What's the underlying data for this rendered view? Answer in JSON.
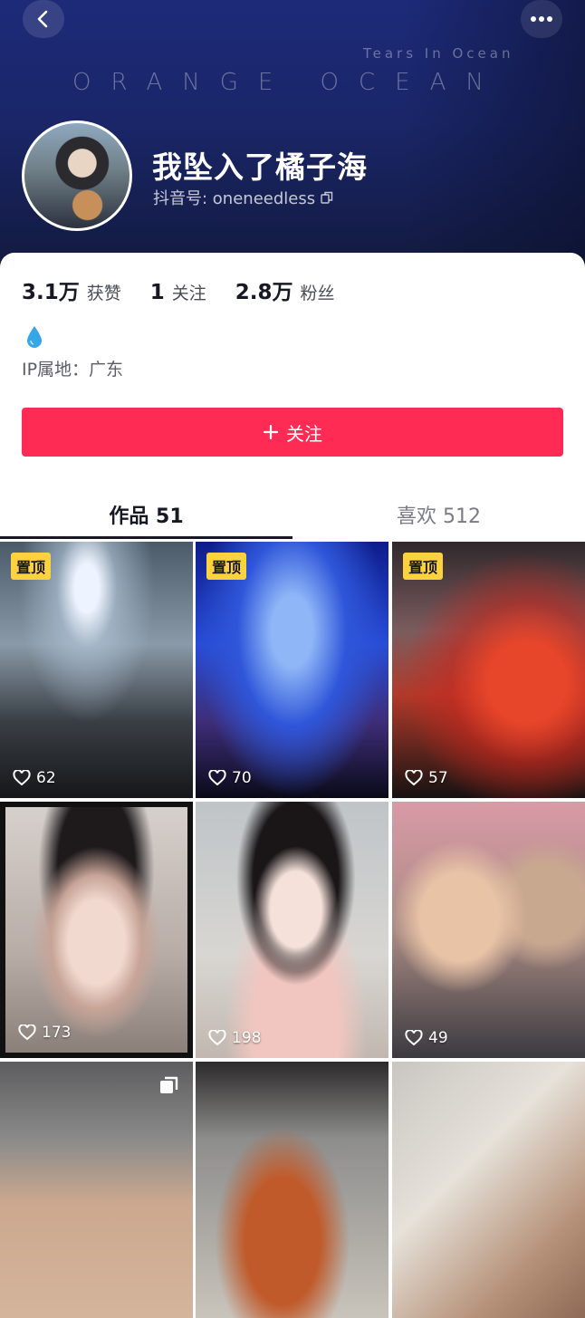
{
  "header": {
    "banner_subtitle": "Tears In Ocean",
    "banner_title": "ORANGE OCEAN",
    "nickname": "我坠入了橘子海",
    "douyin_id": "抖音号: oneneedless"
  },
  "stats": [
    {
      "value": "3.1万",
      "label": "获赞"
    },
    {
      "value": "1",
      "label": "关注"
    },
    {
      "value": "2.8万",
      "label": "粉丝"
    }
  ],
  "bio": {
    "icon": "droplet-icon",
    "ip_location": "IP属地：广东"
  },
  "follow_button": {
    "label": "关注",
    "icon": "plus-icon",
    "color": "#fe2c55"
  },
  "tabs": [
    {
      "label": "作品 51",
      "active": true
    },
    {
      "label": "喜欢 512",
      "active": false
    }
  ],
  "videos": [
    {
      "pinned_label": "置顶",
      "likes": "62"
    },
    {
      "pinned_label": "置顶",
      "likes": "70"
    },
    {
      "pinned_label": "置顶",
      "likes": "57"
    },
    {
      "likes": "173"
    },
    {
      "likes": "198"
    },
    {
      "likes": "49"
    },
    {
      "multi_image": true
    },
    {},
    {}
  ]
}
